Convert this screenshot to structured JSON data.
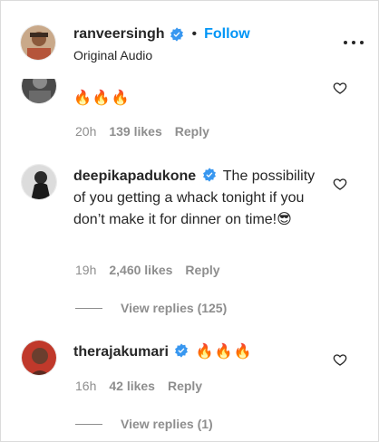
{
  "header": {
    "username": "ranveersingh",
    "separator": "•",
    "follow_label": "Follow",
    "audio_label": "Original Audio"
  },
  "comments": [
    {
      "username": "",
      "text": "🔥🔥🔥",
      "time": "20h",
      "likes": "139 likes",
      "reply_label": "Reply"
    },
    {
      "username": "deepikapadukone",
      "text": "The possibility of you getting a whack tonight if you don’t make it for dinner on time!😎",
      "time": "19h",
      "likes": "2,460 likes",
      "reply_label": "Reply",
      "view_replies": "View replies (125)"
    },
    {
      "username": "therajakumari",
      "text": "🔥🔥🔥",
      "time": "16h",
      "likes": "42 likes",
      "reply_label": "Reply",
      "view_replies": "View replies (1)"
    }
  ],
  "colors": {
    "accent": "#0095f6",
    "verified": "#3897f0",
    "muted": "#8e8e8e"
  }
}
